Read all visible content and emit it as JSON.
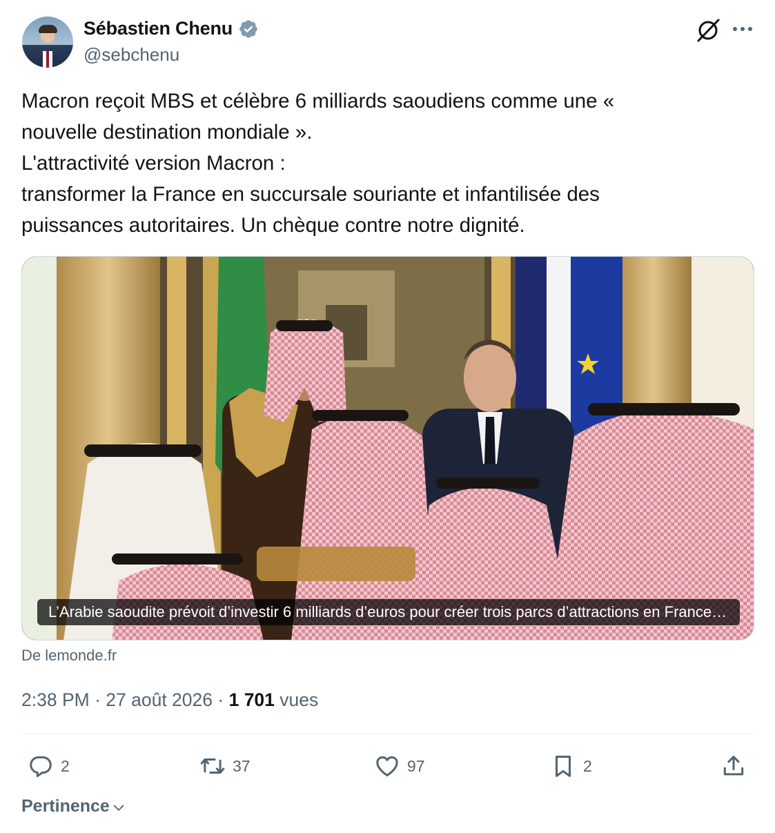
{
  "author": {
    "display_name": "Sébastien Chenu",
    "handle": "@sebchenu",
    "verified": true,
    "verified_color": "#829aab"
  },
  "header_actions": {
    "grok_icon": "grok-icon",
    "more_icon": "more-horizontal-icon"
  },
  "tweet": {
    "lines": [
      "Macron reçoit MBS et célèbre 6 milliards saoudiens comme une «",
      "nouvelle destination mondiale ».",
      "L'attractivité version Macron :",
      "transformer la France en succursale souriante et infantilisée des",
      "puissances autoritaires. Un chèque contre notre dignité."
    ]
  },
  "card": {
    "caption": "L’Arabie saoudite prévoit d’investir 6 milliards d’euros pour créer trois parcs d’attractions en France…",
    "source": "De lemonde.fr"
  },
  "meta": {
    "time": "2:38 PM",
    "separator": "·",
    "date": "27 août 2026",
    "views_count": "1 701",
    "views_label": "vues"
  },
  "actions": {
    "replies": "2",
    "retweets": "37",
    "likes": "97",
    "bookmarks": "2"
  },
  "sort": {
    "label": "Pertinence"
  },
  "colors": {
    "text": "#0f1419",
    "secondary": "#536471",
    "border": "#cfd9de"
  }
}
